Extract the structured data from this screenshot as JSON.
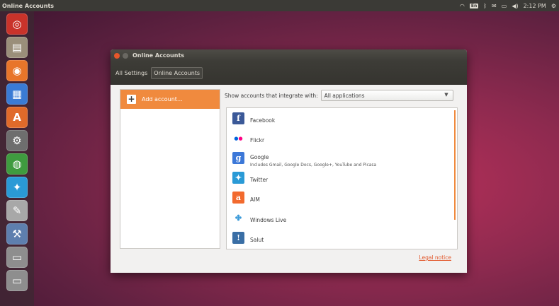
{
  "top_panel": {
    "app_title": "Online Accounts",
    "tray": {
      "keyboard": "En",
      "clock": "2:12 PM"
    }
  },
  "launcher": {
    "items": [
      {
        "icon": "dash-home-icon",
        "glyph": "◎",
        "color": "#c9332a"
      },
      {
        "icon": "files-icon",
        "glyph": "▤",
        "color": "#9a8f7a"
      },
      {
        "icon": "firefox-icon",
        "glyph": "◉",
        "color": "#e8752a"
      },
      {
        "icon": "libreoffice-writer-icon",
        "glyph": "▦",
        "color": "#3a7bd5"
      },
      {
        "icon": "software-center-icon",
        "glyph": "A",
        "color": "#e06a2a"
      },
      {
        "icon": "system-settings-icon",
        "glyph": "⚙",
        "color": "#6e6e6e"
      },
      {
        "icon": "chrome-icon",
        "glyph": "◍",
        "color": "#3f9b3f"
      },
      {
        "icon": "twitter-icon",
        "glyph": "✦",
        "color": "#2a9ad6"
      },
      {
        "icon": "text-editor-icon",
        "glyph": "✎",
        "color": "#a8a8a8"
      },
      {
        "icon": "online-accounts-icon",
        "glyph": "⚒",
        "color": "#5e7fae"
      },
      {
        "icon": "drive-icon",
        "glyph": "▭",
        "color": "#8e8e8e"
      },
      {
        "icon": "drive-icon-2",
        "glyph": "▭",
        "color": "#8e8e8e"
      }
    ]
  },
  "window": {
    "title": "Online Accounts",
    "breadcrumbs": [
      "All Settings",
      "Online Accounts"
    ],
    "add_account_label": "Add account…",
    "filter_label": "Show accounts that integrate with:",
    "filter_value": "All applications",
    "providers": [
      {
        "name": "Facebook",
        "icon": "facebook-icon",
        "glyph": "f",
        "color": "#3b5998"
      },
      {
        "name": "Flickr",
        "icon": "flickr-icon",
        "glyph": "●●",
        "color": "#ffffff"
      },
      {
        "name": "Google",
        "description": "Includes Gmail, Google Docs, Google+, YouTube and Picasa",
        "icon": "google-icon",
        "glyph": "g",
        "color": "#3c78d8"
      },
      {
        "name": "Twitter",
        "icon": "twitter-bird-icon",
        "glyph": "✦",
        "color": "#2a9ad6"
      },
      {
        "name": "AIM",
        "icon": "aim-icon",
        "glyph": "a",
        "color": "#f26a2e"
      },
      {
        "name": "Windows Live",
        "icon": "windows-live-icon",
        "glyph": "✤",
        "color": "#ffffff"
      },
      {
        "name": "Salut",
        "icon": "salut-icon",
        "glyph": "!",
        "color": "#3a6ea5"
      }
    ],
    "legal_notice": "Legal notice"
  },
  "colors": {
    "accent": "#f08a3e",
    "link": "#e2572a"
  }
}
